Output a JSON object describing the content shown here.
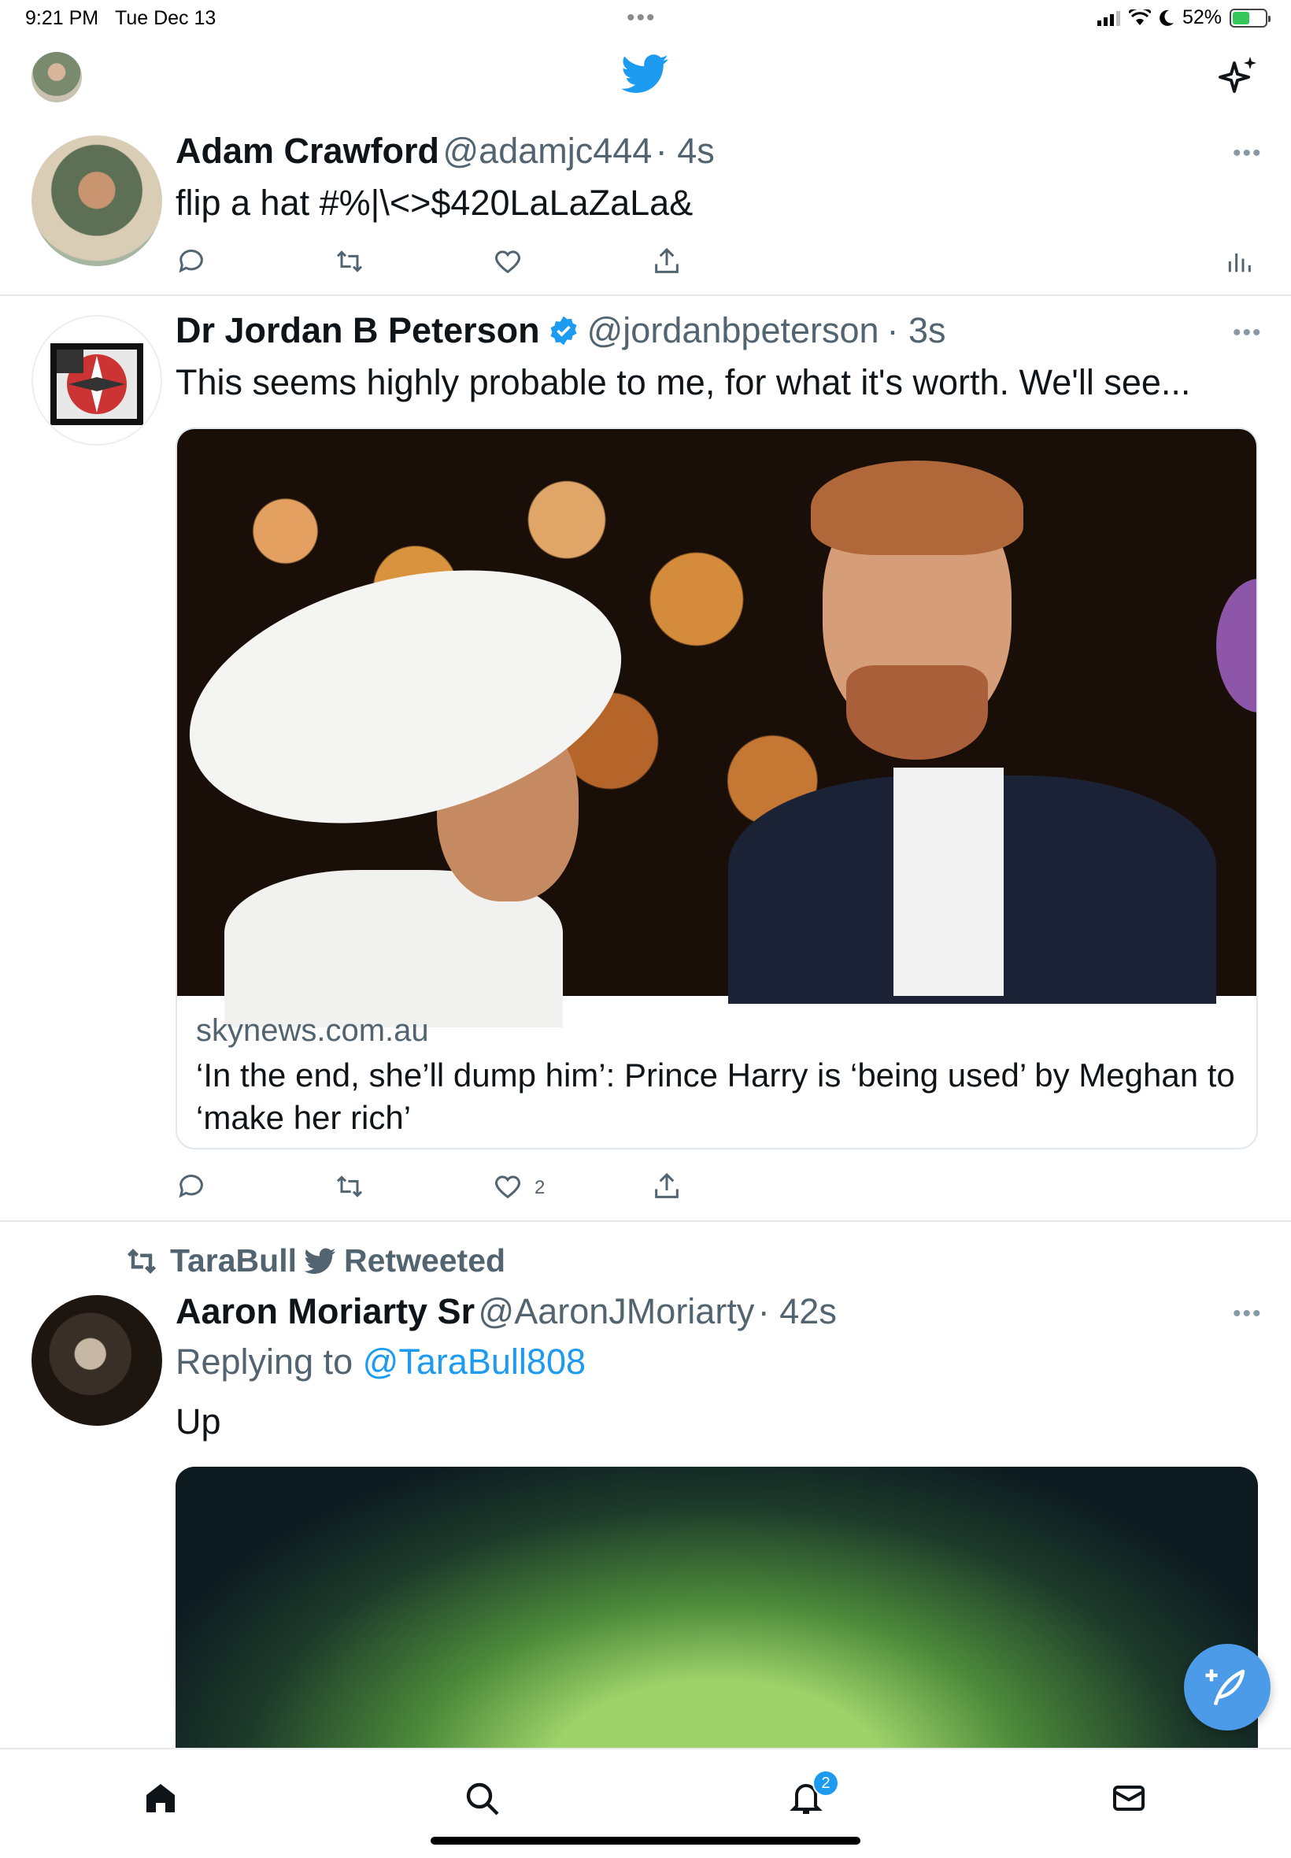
{
  "status_bar": {
    "time": "9:21 PM",
    "date": "Tue Dec 13",
    "battery": "52%",
    "battery_level": 0.52
  },
  "tweets": [
    {
      "name": "Adam Crawford",
      "handle": "@adamjc444",
      "time": "· 4s",
      "text": "flip a hat #%|\\<>$420LaLaZaLa&"
    },
    {
      "name": "Dr Jordan B Peterson",
      "handle": "@jordanbpeterson",
      "time": "· 3s",
      "text": "This seems highly probable to me, for what it's worth. We'll see...",
      "card": {
        "domain": "skynews.com.au",
        "title": "‘In the end, she’ll dump him’: Prince Harry is ‘being used’ by Meghan to ‘make her rich’"
      },
      "like_count": "2"
    },
    {
      "retweeted_by": "TaraBull",
      "retweeted_label": "Retweeted",
      "name": "Aaron Moriarty Sr",
      "handle": "@AaronJMoriarty",
      "time": "· 42s",
      "replying_to_label": "Replying to",
      "replying_to": "@TaraBull808",
      "text": "Up"
    }
  ],
  "more_glyph": "•••",
  "notifications_badge": "2",
  "colors": {
    "accent": "#1d9bf0",
    "fab": "#4c9be8",
    "text": "#0f1419",
    "secondary": "#536471"
  }
}
